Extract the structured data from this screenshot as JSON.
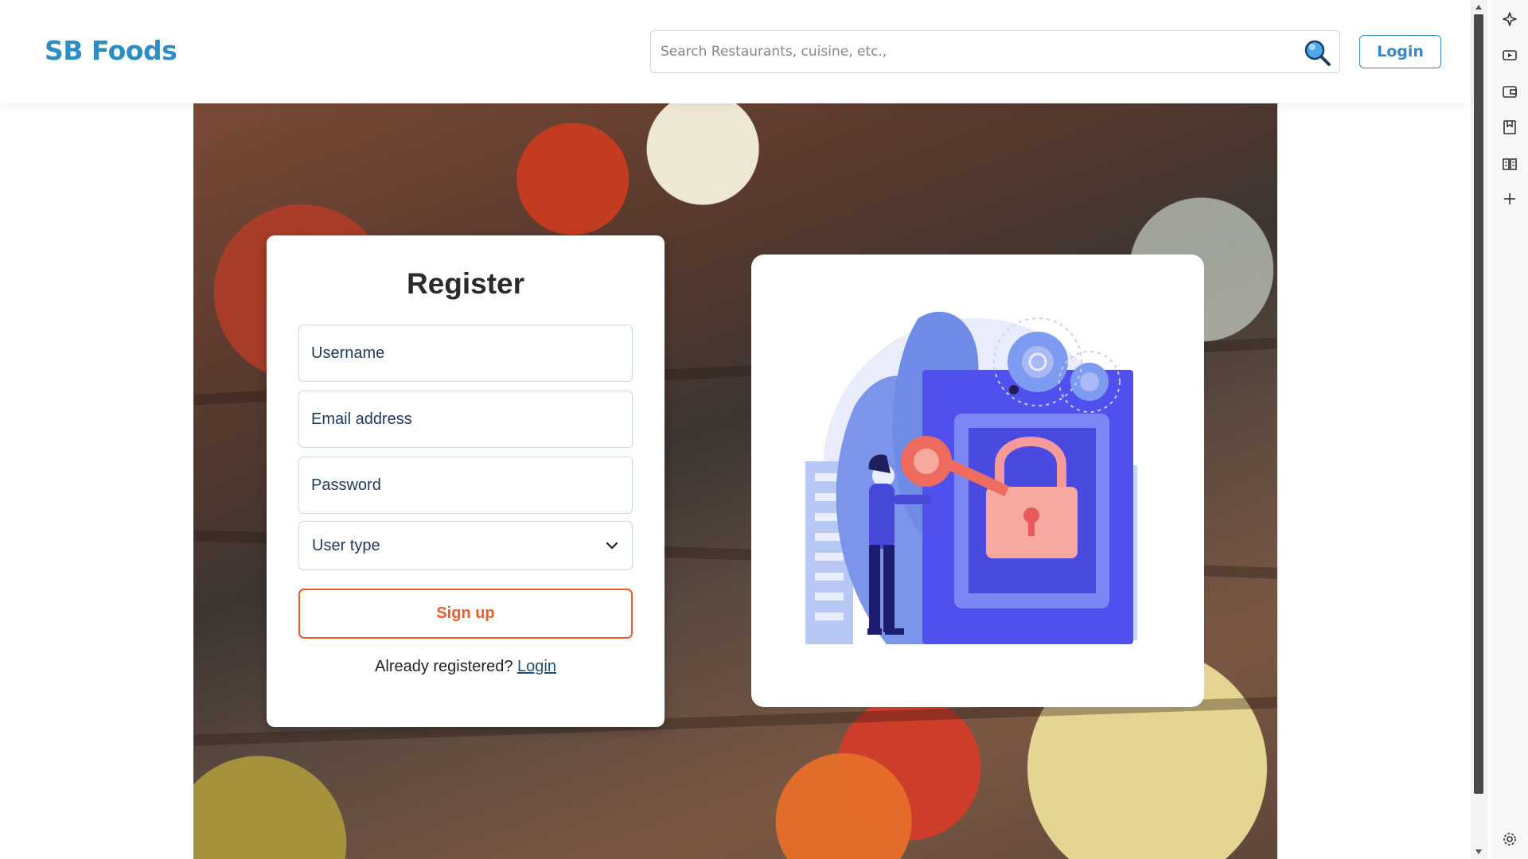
{
  "navbar": {
    "brand": "SB Foods",
    "search_placeholder": "Search Restaurants, cuisine, etc.,",
    "search_icon": "search-icon",
    "login_label": "Login"
  },
  "register": {
    "title": "Register",
    "username_placeholder": "Username",
    "email_placeholder": "Email address",
    "password_placeholder": "Password",
    "user_type": "User type",
    "signup_label": "Sign up",
    "already_text": "Already registered?",
    "login_link": "Login"
  },
  "illustration": {
    "icon": "padlock-key-illustration"
  },
  "side_panel": {
    "icons": [
      "sparkle-icon",
      "media-icon",
      "wallet-icon",
      "bookmark-icon",
      "reader-icon",
      "plus-icon",
      "settings-icon"
    ]
  },
  "colors": {
    "brand": "#2f8dc5",
    "accent": "#ef5a2a",
    "link": "#1f4e79",
    "illustration_primary": "#5050ef"
  }
}
